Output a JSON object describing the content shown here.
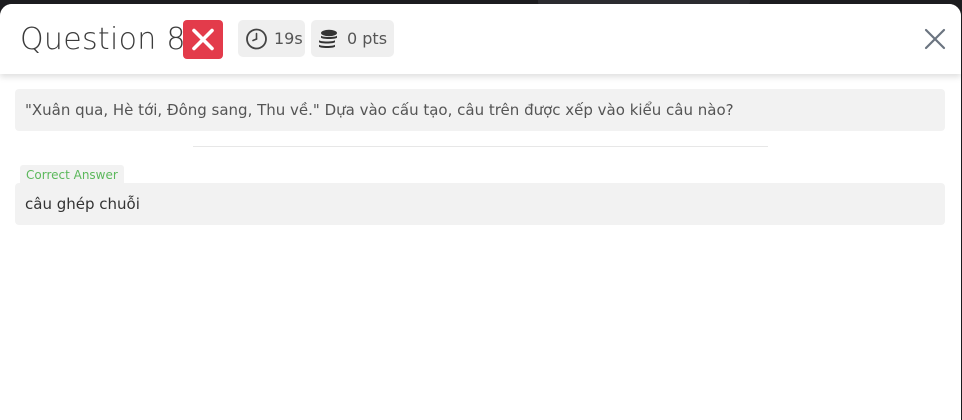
{
  "header": {
    "title": "Question 8",
    "result_icon": "wrong-x-icon",
    "time_icon": "clock-icon",
    "time": "19s",
    "points_icon": "coins-icon",
    "points": "0 pts",
    "close_icon": "close-icon"
  },
  "question": {
    "text": "\"Xuân qua, Hè tới, Đông sang, Thu về.\" Dựa vào cấu tạo, câu trên được xếp vào kiểu câu nào?"
  },
  "answer": {
    "label": "Correct Answer",
    "text": "câu ghép chuỗi"
  },
  "colors": {
    "wrong": "#e33b4b",
    "correct_label": "#5cb85c",
    "panel_bg": "#f2f2f2"
  }
}
